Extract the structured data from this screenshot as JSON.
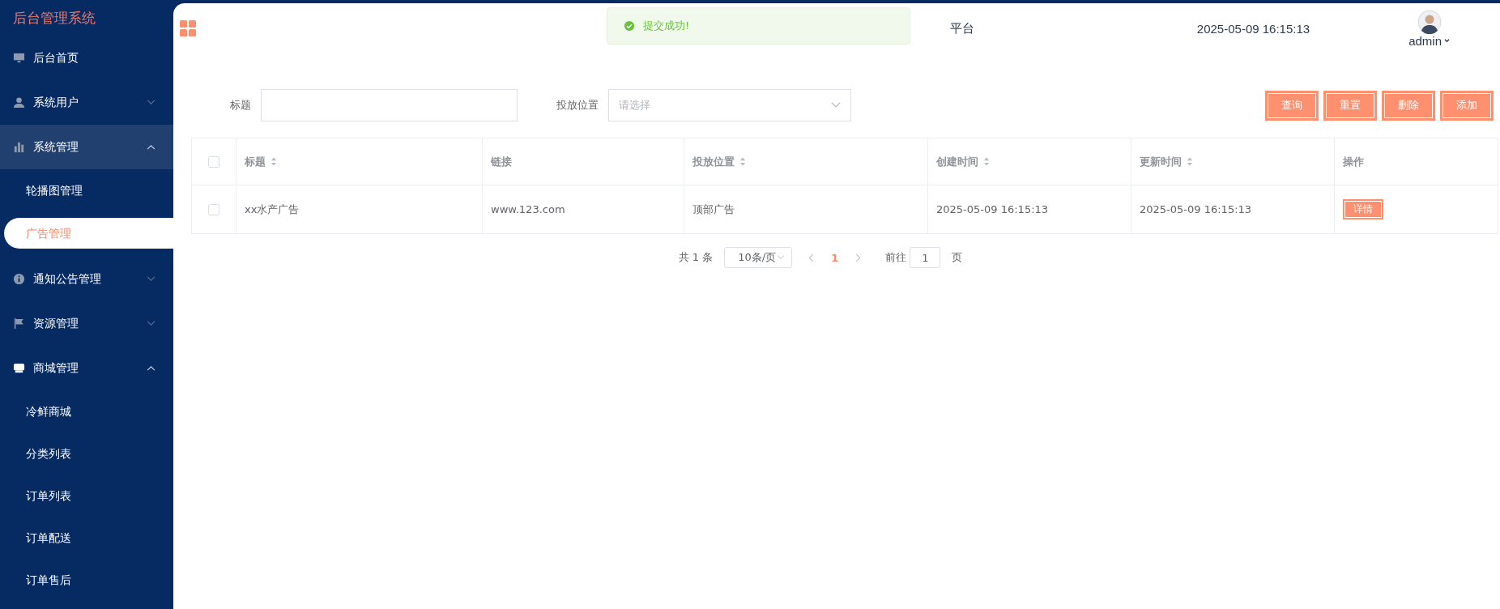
{
  "sidebar": {
    "title": "后台管理系统",
    "items": [
      {
        "label": "后台首页",
        "kind": "link",
        "hovered": false
      },
      {
        "label": "系统用户",
        "kind": "group",
        "hovered": false,
        "expanded": false
      },
      {
        "label": "系统管理",
        "kind": "group",
        "hovered": true,
        "expanded": true,
        "children": [
          {
            "label": "轮播图管理",
            "selected": false
          },
          {
            "label": "广告管理",
            "selected": true
          }
        ]
      },
      {
        "label": "通知公告管理",
        "kind": "group",
        "hovered": false,
        "expanded": false
      },
      {
        "label": "资源管理",
        "kind": "group",
        "hovered": false,
        "expanded": false
      },
      {
        "label": "商城管理",
        "kind": "group",
        "hovered": false,
        "expanded": true,
        "children": [
          {
            "label": "冷鲜商城",
            "selected": false
          },
          {
            "label": "分类列表",
            "selected": false
          },
          {
            "label": "订单列表",
            "selected": false
          },
          {
            "label": "订单配送",
            "selected": false
          },
          {
            "label": "订单售后",
            "selected": false
          }
        ]
      }
    ]
  },
  "header": {
    "title": "平台",
    "datetime": "2025-05-09 16:15:13",
    "user": "admin"
  },
  "toast": {
    "message": "提交成功!"
  },
  "filters": [
    {
      "label": "标题",
      "kind": "text"
    },
    {
      "label": "投放位置",
      "kind": "select",
      "placeholder": "请选择"
    }
  ],
  "buttons": [
    "查询",
    "重置",
    "删除",
    "添加"
  ],
  "table": {
    "all_selected": false,
    "columns": [
      {
        "label": "标题",
        "sortable": true
      },
      {
        "label": "链接",
        "sortable": false
      },
      {
        "label": "投放位置",
        "sortable": true
      },
      {
        "label": "创建时间",
        "sortable": true
      },
      {
        "label": "更新时间",
        "sortable": true
      },
      {
        "label": "操作",
        "sortable": false
      }
    ],
    "rows": [
      {
        "selected": false,
        "cells": [
          "xx水产广告",
          "www.123.com",
          "顶部广告",
          "2025-05-09 16:15:13",
          "2025-05-09 16:15:13"
        ],
        "action": "详情"
      }
    ]
  },
  "pagination": {
    "total": "共 1 条",
    "page_size": "10条/页",
    "pages": [
      {
        "label": "1",
        "selected": true
      }
    ],
    "goto_label": "前往",
    "goto_value": "1",
    "goto_suffix": "页"
  }
}
